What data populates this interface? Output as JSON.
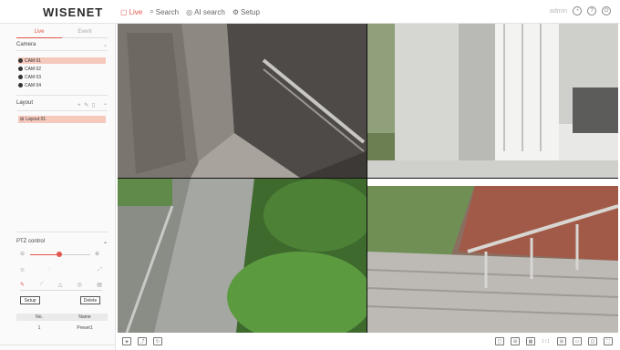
{
  "app": {
    "logo": "WISENET",
    "nav": [
      {
        "label": "Live",
        "icon": "live-icon",
        "active": true
      },
      {
        "label": "Search",
        "icon": "search-icon",
        "active": false
      },
      {
        "label": "AI search",
        "icon": "ai-search-icon",
        "active": false
      },
      {
        "label": "Setup",
        "icon": "gear-icon",
        "active": false
      }
    ],
    "user": "admin",
    "accent": "#e2574c"
  },
  "sidebar": {
    "tabs": [
      {
        "label": "Live",
        "active": true
      },
      {
        "label": "Event",
        "active": false
      }
    ],
    "camera_header": "Camera",
    "cameras": [
      {
        "label": "CAM 01",
        "selected": true
      },
      {
        "label": "CAM 02",
        "selected": false
      },
      {
        "label": "CAM 03",
        "selected": false
      },
      {
        "label": "CAM 04",
        "selected": false
      }
    ],
    "layout_header": "Layout",
    "layout_item": "Layout 01",
    "ptz_header": "PTZ control",
    "zoom_level": 0.45,
    "setup_label": "Setup",
    "delete_label": "Delete",
    "preset_table": {
      "headers": [
        "No.",
        "Name"
      ],
      "rows": [
        [
          "1",
          "Preset1"
        ]
      ]
    }
  },
  "grid": {
    "tiles": [
      "corridor-elevator",
      "lobby-atrium",
      "walkway-garden",
      "stairs-railing"
    ]
  },
  "toolbar": {
    "page_indicator": "1/1"
  }
}
